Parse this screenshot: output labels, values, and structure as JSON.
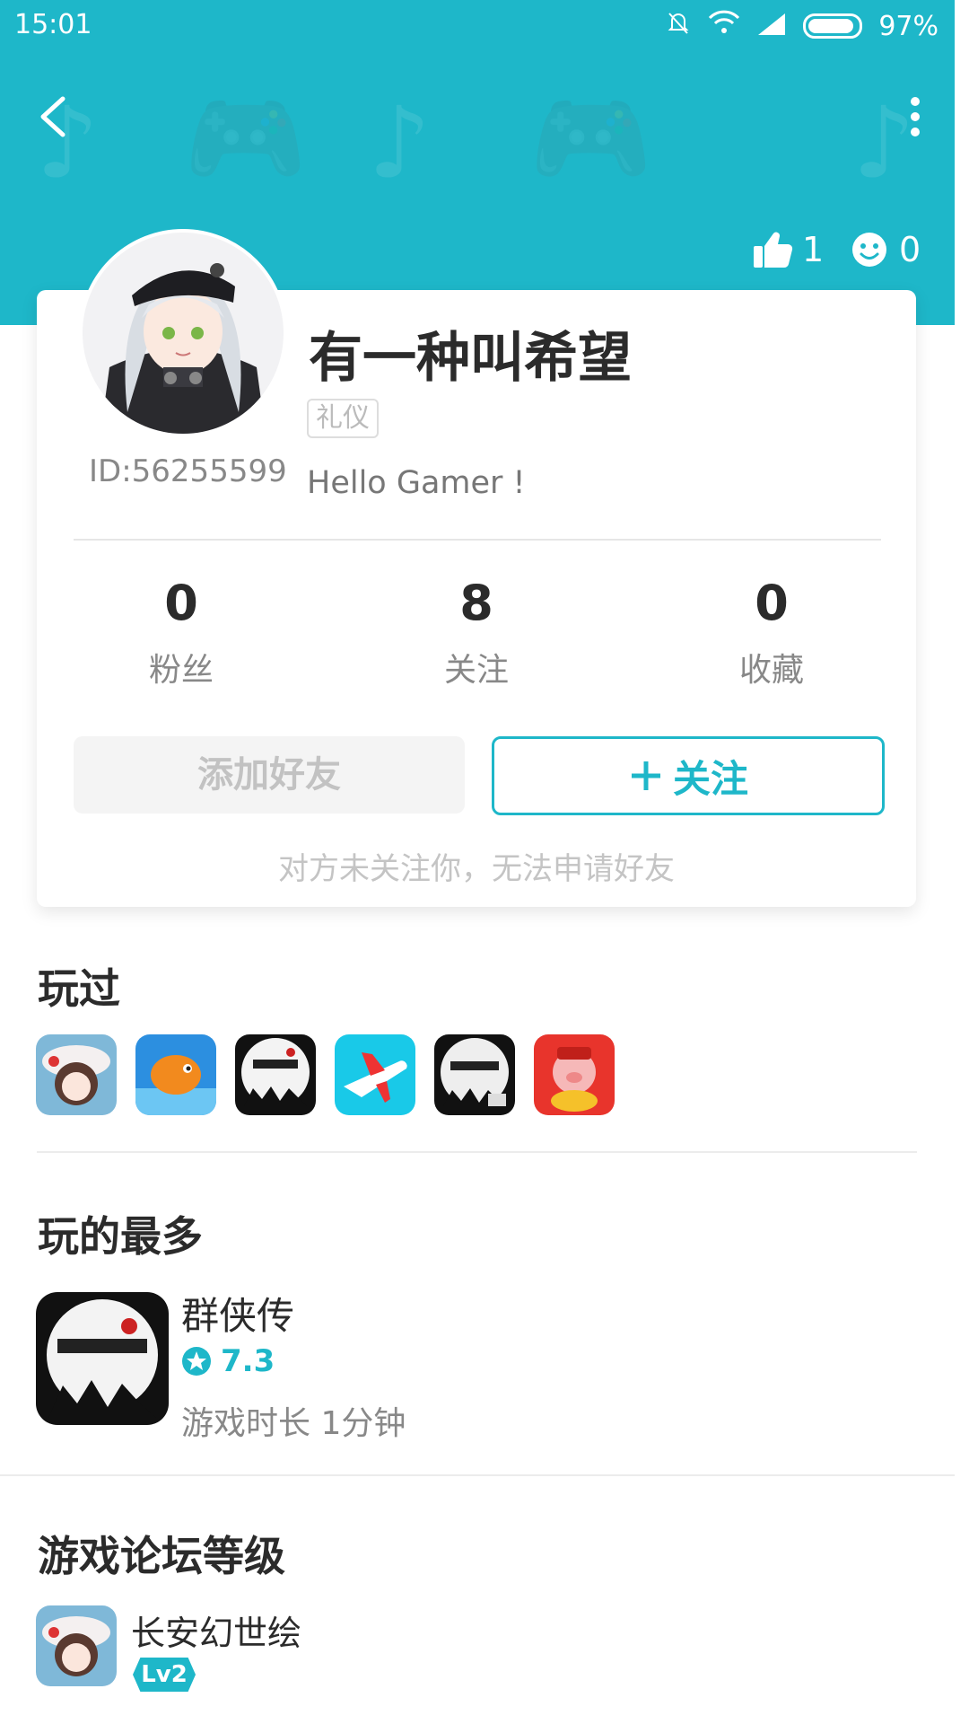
{
  "status_bar": {
    "time": "15:01",
    "battery": "97%"
  },
  "profile": {
    "likes": "1",
    "smiles": "0",
    "user_id": "ID:56255599",
    "username": "有一种叫希望",
    "tag": "礼仪",
    "bio": "Hello Gamer !"
  },
  "counts": [
    {
      "value": "0",
      "label": "粉丝"
    },
    {
      "value": "8",
      "label": "关注"
    },
    {
      "value": "0",
      "label": "收藏"
    }
  ],
  "actions": {
    "add_friend": "添加好友",
    "follow": "关注",
    "hint": "对方未关注你，无法申请好友"
  },
  "played": {
    "title": "玩过",
    "games": [
      "chibi-girl-game-icon",
      "fish-game-icon",
      "qunxiazhuan-icon",
      "airplane-game-icon",
      "qunxiazhuan-alt-icon",
      "lucky-pig-icon"
    ]
  },
  "most_played": {
    "title": "玩的最多",
    "game_name": "群侠传",
    "rating": "7.3",
    "play_time": "游戏时长 1分钟"
  },
  "forum_level": {
    "title": "游戏论坛等级",
    "game_name": "长安幻世绘",
    "level": "Lv2"
  },
  "colors": {
    "accent": "#1eb7c9"
  }
}
